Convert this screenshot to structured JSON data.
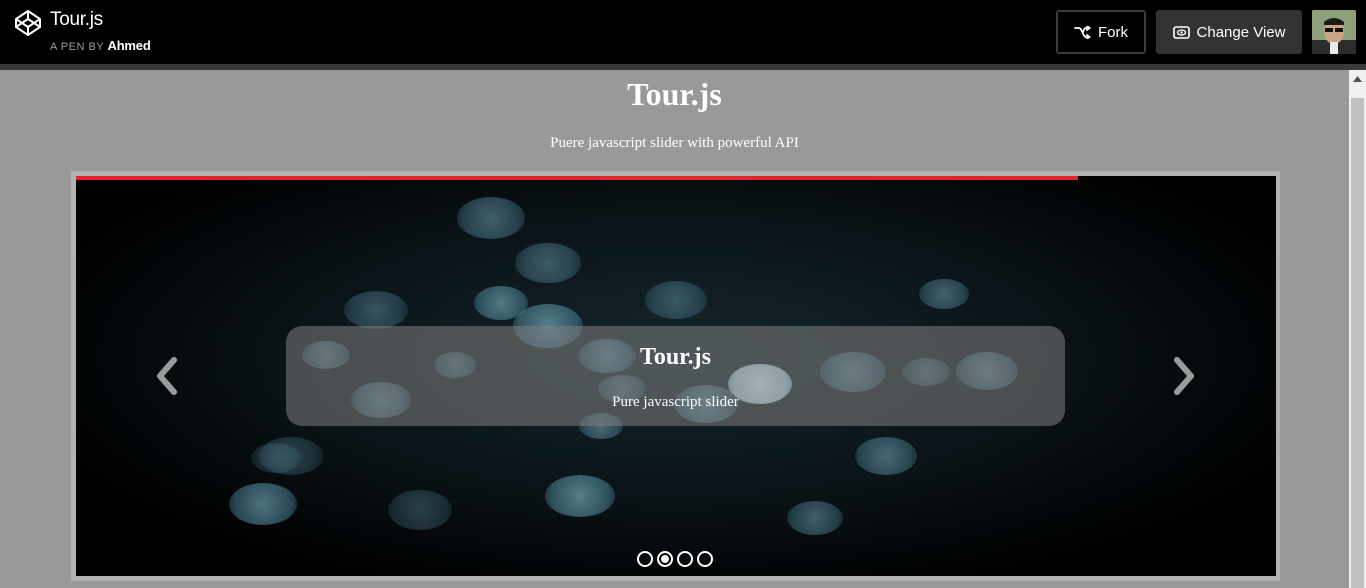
{
  "header": {
    "pen_title": "Tour.js",
    "pen_by_label": "A PEN BY",
    "author": "Ahmed",
    "fork_label": "Fork",
    "change_view_label": "Change View",
    "logo_icon": "codepen-logo-icon",
    "fork_icon": "fork-icon",
    "view_icon": "eye-icon"
  },
  "page": {
    "title": "Tour.js",
    "subtitle": "Puere javascript slider with powerful API"
  },
  "slider": {
    "caption_title": "Tour.js",
    "caption_text": "Pure javascript slider",
    "progress": 0.835,
    "slide_count": 4,
    "active_slide": 2,
    "progress_color": "#e0262b"
  },
  "colors": {
    "page_bg": "#999999",
    "topbar_bg": "#000000",
    "accent": "#e0262b"
  }
}
